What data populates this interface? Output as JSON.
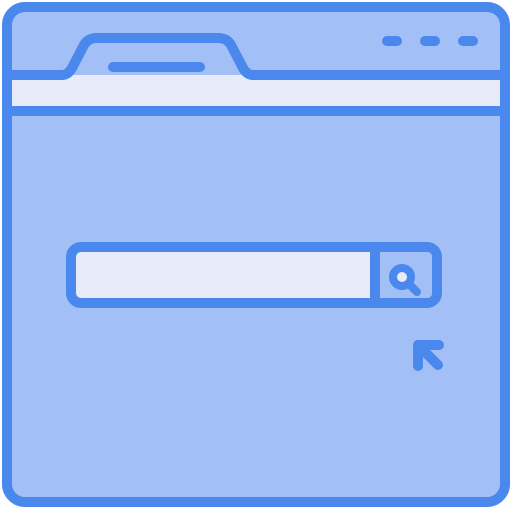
{
  "icon": {
    "name": "browser-search-icon",
    "colors": {
      "stroke": "#4a88ee",
      "window_fill": "#a2bff6",
      "bar_fill": "#e8ebfa"
    },
    "window": {
      "control_dots": 3
    },
    "search": {
      "icon_name": "search-icon",
      "value": ""
    },
    "cursor": {
      "icon_name": "pointer-arrow-icon"
    }
  }
}
